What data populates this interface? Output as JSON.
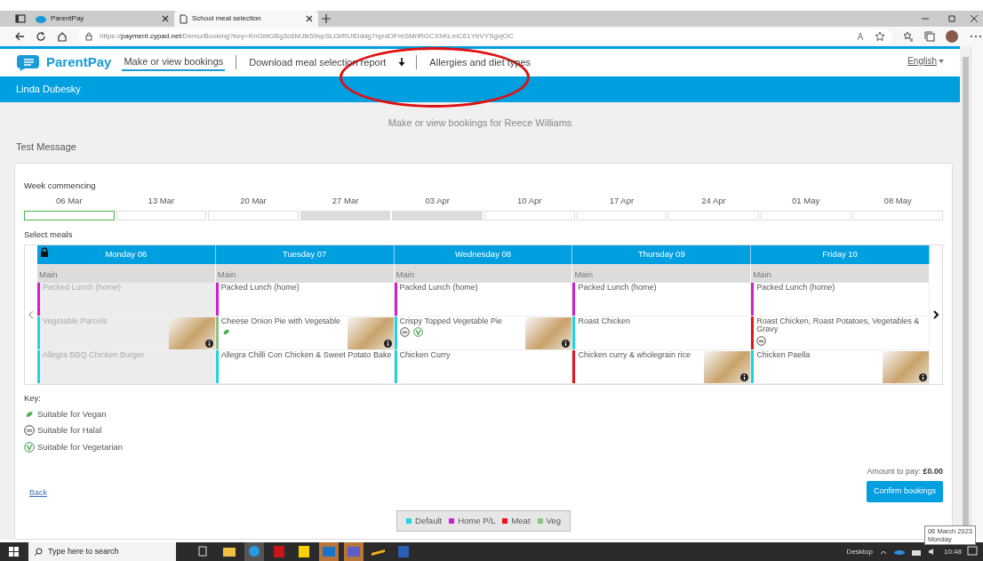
{
  "browser": {
    "tabs": [
      {
        "label": "ParentPay",
        "selected": false
      },
      {
        "label": "School meal selection",
        "selected": true
      }
    ],
    "url": "https://**payment.cypad.net**/Demo/Booking?key=KnGbtGBg3c6MJtk59spSLt3rRUtDddg7njzdOFmSMrlRGCXhKLmC61YbVYSgvjOC"
  },
  "nav": {
    "brand": "ParentPay",
    "links": [
      {
        "label": "Make or view bookings",
        "selected": true,
        "kind": "plain"
      },
      {
        "label": "Download meal selection report",
        "selected": false,
        "kind": "download"
      },
      {
        "label": "Allergies and diet types",
        "selected": false,
        "kind": "plain"
      }
    ],
    "language": "English"
  },
  "highlight": {
    "kind": "ellipse"
  },
  "user": "Linda Dubesky",
  "page_title": "Make or view bookings for Reece Williams",
  "message": "Test Message",
  "week": {
    "label": "Week commencing",
    "weeks": [
      {
        "label": "06 Mar",
        "selected": true,
        "available": true
      },
      {
        "label": "13 Mar",
        "selected": false,
        "available": true
      },
      {
        "label": "20 Mar",
        "selected": false,
        "available": true
      },
      {
        "label": "27 Mar",
        "selected": false,
        "available": false
      },
      {
        "label": "03 Apr",
        "selected": false,
        "available": false
      },
      {
        "label": "10 Apr",
        "selected": false,
        "available": true
      },
      {
        "label": "17 Apr",
        "selected": false,
        "available": true
      },
      {
        "label": "24 Apr",
        "selected": false,
        "available": true
      },
      {
        "label": "01 May",
        "selected": false,
        "available": true
      },
      {
        "label": "08 May",
        "selected": false,
        "available": true
      }
    ]
  },
  "meals_label": "Select meals",
  "days": [
    {
      "label": "Monday 06",
      "locked": true,
      "course": "Main",
      "meals": [
        {
          "name": "Packed Lunch (home)",
          "color": "#d21ed2",
          "photo": false
        },
        {
          "name": "Vegetable Parcels",
          "color": "#22d3e0",
          "photo": true
        },
        {
          "name": "Allegra BBQ Chicken Burger",
          "color": "#22d3e0",
          "photo": false
        }
      ]
    },
    {
      "label": "Tuesday 07",
      "locked": false,
      "course": "Main",
      "meals": [
        {
          "name": "Packed Lunch (home)",
          "color": "#d21ed2",
          "photo": false
        },
        {
          "name": "Cheese Onion Pie with Vegetable",
          "color": "#8fc18a",
          "photo": true,
          "diets": [
            {
              "kind": "vegan"
            }
          ]
        },
        {
          "name": "Allegra Chilli Con Chicken & Sweet Potato Bake",
          "color": "#22d3e0",
          "photo": false
        }
      ]
    },
    {
      "label": "Wednesday 08",
      "locked": false,
      "course": "Main",
      "meals": [
        {
          "name": "Packed Lunch (home)",
          "color": "#d21ed2",
          "photo": false
        },
        {
          "name": "Crispy Topped Vegetable Pie",
          "color": "#22d3e0",
          "photo": true,
          "diets": [
            {
              "kind": "halal"
            },
            {
              "kind": "vegetarian"
            }
          ]
        },
        {
          "name": "Chicken Curry",
          "color": "#22d3e0",
          "photo": false
        }
      ]
    },
    {
      "label": "Thursday 09",
      "locked": false,
      "course": "Main",
      "meals": [
        {
          "name": "Packed Lunch (home)",
          "color": "#d21ed2",
          "photo": false
        },
        {
          "name": "Roast Chicken",
          "color": "#22d3e0",
          "photo": false
        },
        {
          "name": "Chicken curry & wholegrain rice",
          "color": "#e8141b",
          "photo": true
        }
      ]
    },
    {
      "label": "Friday 10",
      "locked": false,
      "course": "Main",
      "meals": [
        {
          "name": "Packed Lunch (home)",
          "color": "#d21ed2",
          "photo": false
        },
        {
          "name": "Roast Chicken, Roast Potatoes, Vegetables & Gravy",
          "color": "#e8141b",
          "photo": false,
          "diets": [
            {
              "kind": "halal"
            }
          ]
        },
        {
          "name": "Chicken Paella",
          "color": "#22d3e0",
          "photo": true
        }
      ]
    }
  ],
  "key": {
    "label": "Key:",
    "items": [
      {
        "kind": "vegan",
        "label": "Suitable for Vegan"
      },
      {
        "kind": "halal",
        "label": "Suitable for Halal"
      },
      {
        "kind": "vegetarian",
        "label": "Suitable for Vegetarian"
      }
    ]
  },
  "back": "Back",
  "amount": "Amount to pay: **£0.00**",
  "confirm": "Confirm bookings",
  "legend": [
    {
      "label": "Default",
      "color": "#22d3e0"
    },
    {
      "label": "Home P/L",
      "color": "#d21ed2"
    },
    {
      "label": "Meat",
      "color": "#e8141b"
    },
    {
      "label": "Veg",
      "color": "#8fc18a"
    }
  ],
  "taskbar": {
    "search_placeholder": "Type here to search",
    "desktop": "Desktop",
    "time": "10:48"
  },
  "tooltip": [
    "06 March 2023",
    "Monday"
  ]
}
